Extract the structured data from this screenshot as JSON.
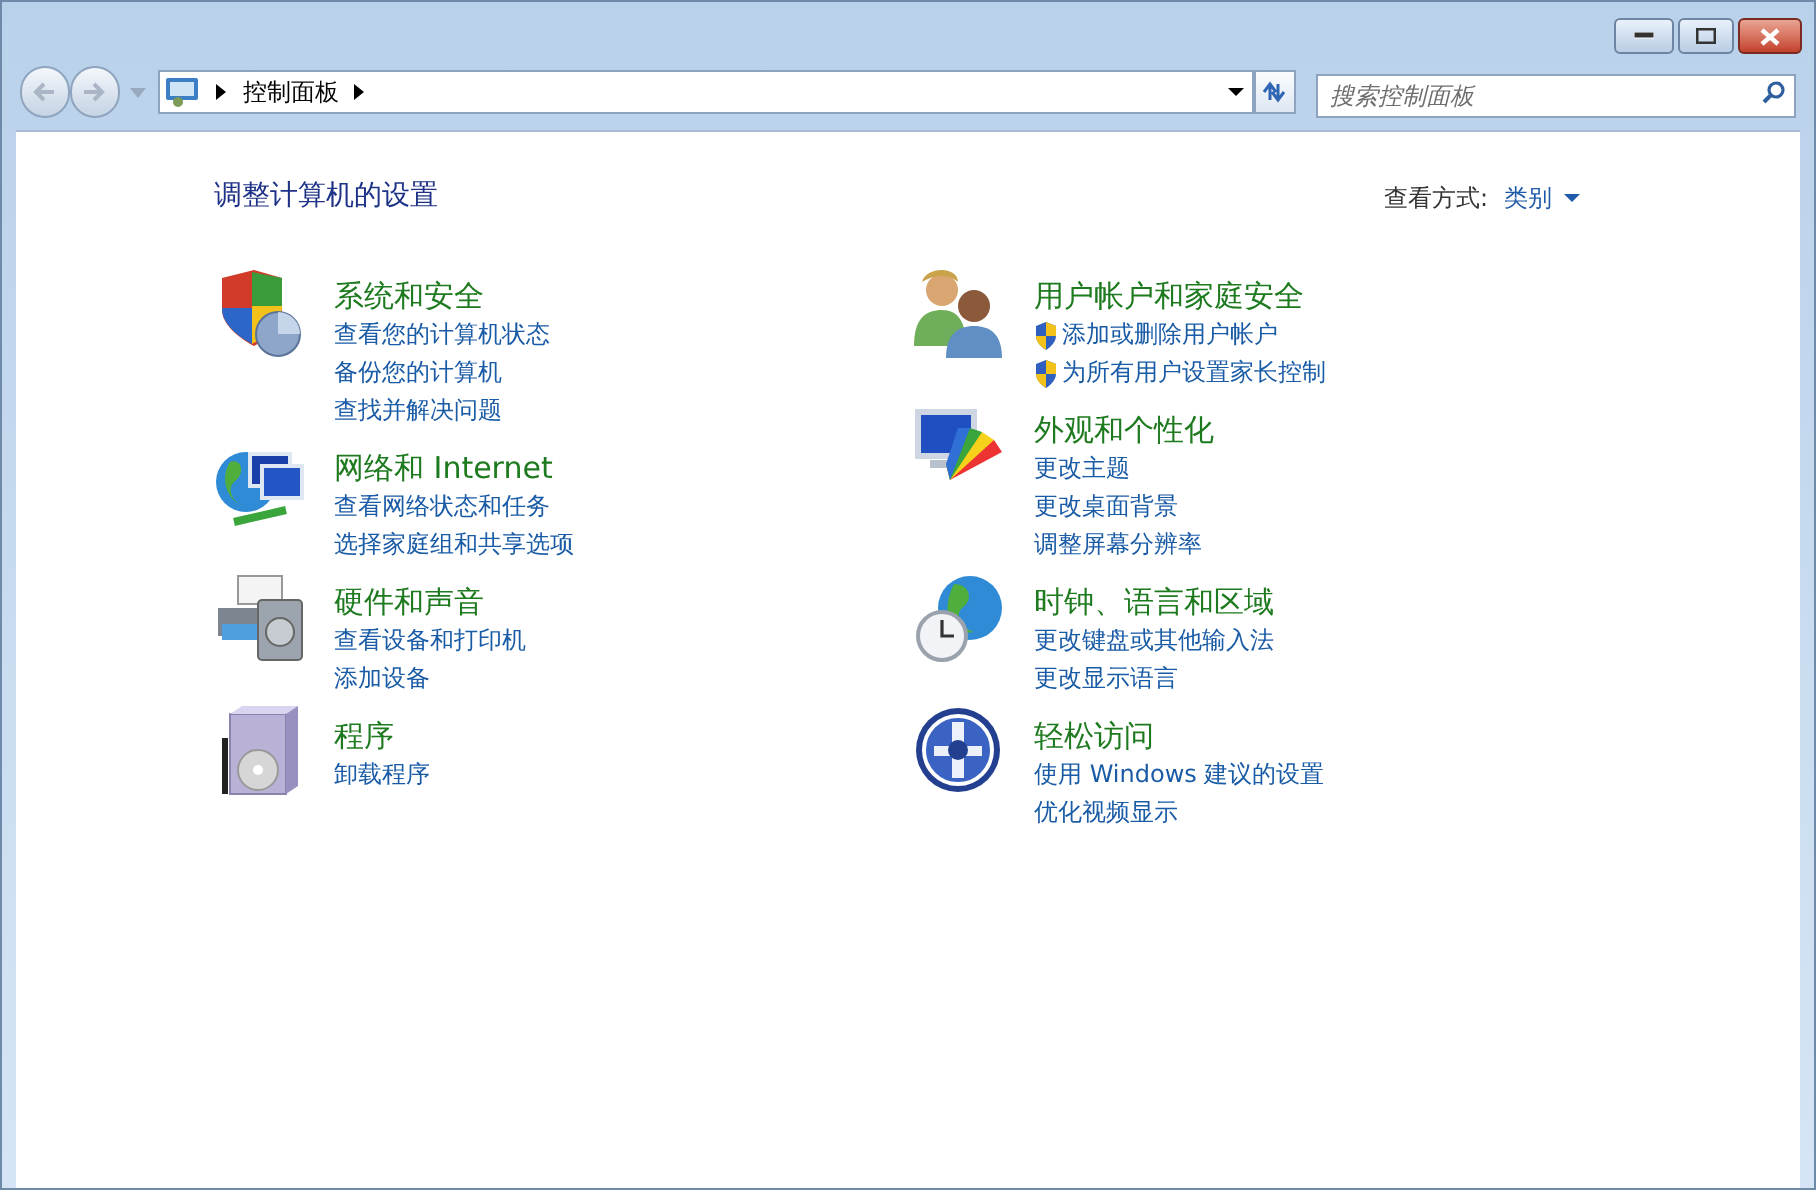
{
  "address_bar": {
    "path": [
      "控制面板"
    ]
  },
  "search": {
    "placeholder": "搜索控制面板"
  },
  "heading": "调整计算机的设置",
  "view_by": {
    "label": "查看方式:",
    "value": "类别"
  },
  "columns": [
    [
      {
        "title": "系统和安全",
        "links": [
          {
            "text": "查看您的计算机状态"
          },
          {
            "text": "备份您的计算机"
          },
          {
            "text": "查找并解决问题"
          }
        ]
      },
      {
        "title": "网络和 Internet",
        "links": [
          {
            "text": "查看网络状态和任务"
          },
          {
            "text": "选择家庭组和共享选项"
          }
        ]
      },
      {
        "title": "硬件和声音",
        "links": [
          {
            "text": "查看设备和打印机"
          },
          {
            "text": "添加设备"
          }
        ]
      },
      {
        "title": "程序",
        "links": [
          {
            "text": "卸载程序"
          }
        ]
      }
    ],
    [
      {
        "title": "用户帐户和家庭安全",
        "links": [
          {
            "text": "添加或删除用户帐户",
            "shield": true
          },
          {
            "text": "为所有用户设置家长控制",
            "shield": true
          }
        ]
      },
      {
        "title": "外观和个性化",
        "links": [
          {
            "text": "更改主题"
          },
          {
            "text": "更改桌面背景"
          },
          {
            "text": "调整屏幕分辨率"
          }
        ]
      },
      {
        "title": "时钟、语言和区域",
        "links": [
          {
            "text": "更改键盘或其他输入法"
          },
          {
            "text": "更改显示语言"
          }
        ]
      },
      {
        "title": "轻松访问",
        "links": [
          {
            "text": "使用 Windows 建议的设置"
          },
          {
            "text": "优化视频显示"
          }
        ]
      }
    ]
  ]
}
